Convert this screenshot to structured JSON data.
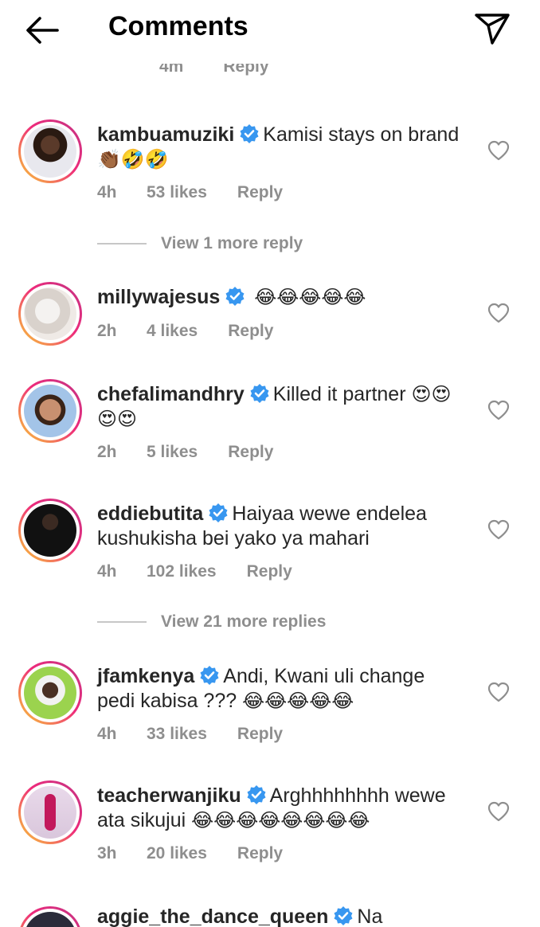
{
  "header": {
    "title": "Comments",
    "back_icon": "arrow-left-icon",
    "share_icon": "paper-plane-icon"
  },
  "partial_top": {
    "time": "4m",
    "reply": "Reply"
  },
  "comments": [
    {
      "username": "kambuamuziki",
      "verified": true,
      "text": "Kamisi stays on brand",
      "emojis": "👏🏾🤣🤣",
      "time": "4h",
      "likes": "53 likes",
      "reply": "Reply"
    },
    {
      "username": "millywajesus",
      "verified": true,
      "text": "",
      "emojis": "😂😂😂😂😂",
      "time": "2h",
      "likes": "4 likes",
      "reply": "Reply"
    },
    {
      "username": "chefalimandhry",
      "verified": true,
      "text": "Killed it partner",
      "emojis": "😍😍😍😍",
      "time": "2h",
      "likes": "5 likes",
      "reply": "Reply"
    },
    {
      "username": "eddiebutita",
      "verified": true,
      "text": "Haiyaa wewe endelea kushukisha bei yako ya mahari",
      "emojis": "",
      "time": "4h",
      "likes": "102 likes",
      "reply": "Reply"
    },
    {
      "username": "jfamkenya",
      "verified": true,
      "text": "Andi, Kwani uli change pedi kabisa ???",
      "emojis": "😂😂😂😂😂",
      "time": "4h",
      "likes": "33 likes",
      "reply": "Reply"
    },
    {
      "username": "teacherwanjiku",
      "verified": true,
      "text": "Arghhhhhhhh wewe ata sikujui",
      "emojis": "😂😂😂😂😂😂😂😂",
      "time": "3h",
      "likes": "20 likes",
      "reply": "Reply"
    }
  ],
  "view_more": [
    {
      "label": "View 1 more reply"
    },
    {
      "label": "View 21 more replies"
    }
  ],
  "bottom_partial": {
    "username": "aggie_the_dance_queen",
    "text": "Na"
  },
  "colors": {
    "text": "#262626",
    "meta": "#8e8e8e",
    "verified": "#3897f0",
    "ring_start": "#f9ce34",
    "ring_end": "#c13584"
  }
}
